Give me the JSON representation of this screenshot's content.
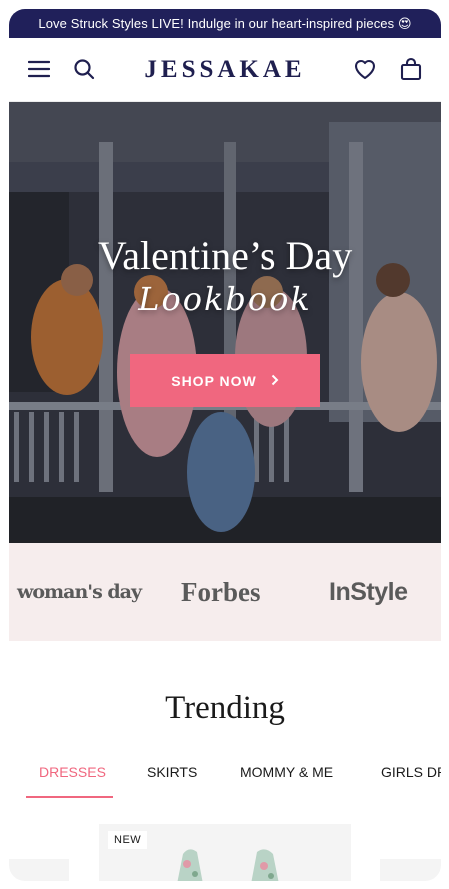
{
  "announcement": {
    "text": "Love Struck Styles LIVE! Indulge in our heart-inspired pieces 😍"
  },
  "header": {
    "logo": "JESSAKAE",
    "menu_icon": "hamburger-menu-icon",
    "search_icon": "search-icon",
    "wishlist_icon": "heart-icon",
    "cart_icon": "shopping-bag-icon"
  },
  "hero": {
    "title": "Valentine’s Day",
    "subtitle": "Lookbook",
    "cta_label": "SHOP NOW",
    "cta_icon": "chevron-right-icon"
  },
  "press": {
    "logos": [
      "woman's day",
      "Forbes",
      "InStyle"
    ]
  },
  "trending": {
    "title": "Trending",
    "tabs": [
      "DRESSES",
      "SKIRTS",
      "MOMMY & ME",
      "GIRLS DR"
    ],
    "active_tab": "DRESSES"
  },
  "product": {
    "badge": "NEW"
  },
  "colors": {
    "navy": "#20205a",
    "accent_pink": "#f0677f",
    "press_bg": "#f6eded"
  }
}
